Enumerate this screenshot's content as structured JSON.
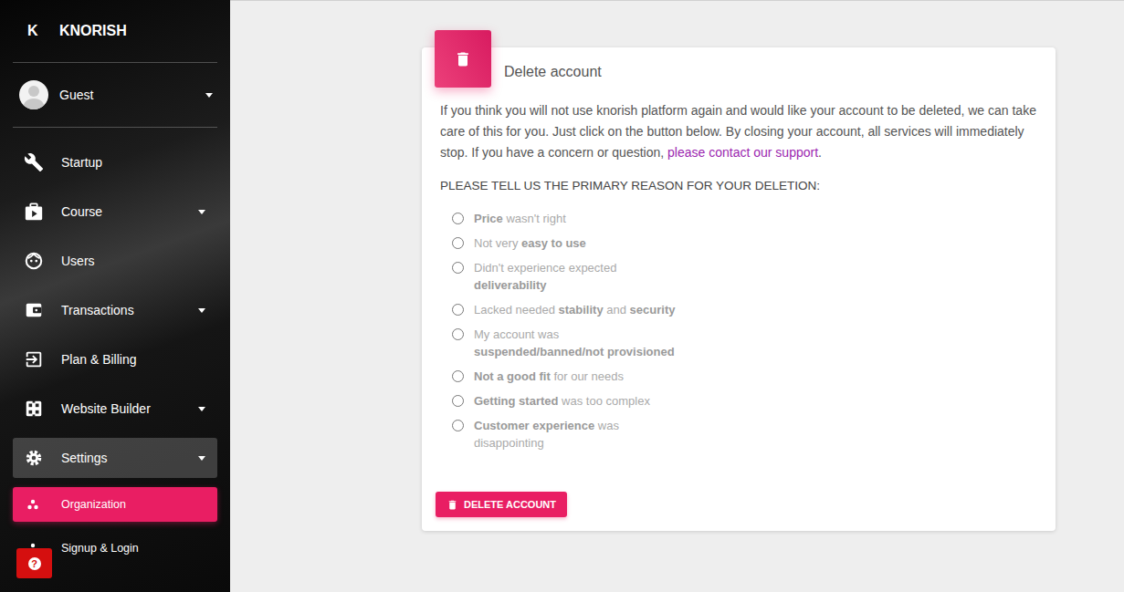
{
  "brand": {
    "logo": "K",
    "name": "KNORISH"
  },
  "user": {
    "name": "Guest",
    "expanded": false
  },
  "sidebar": {
    "items": [
      {
        "label": "Startup",
        "expandable": false,
        "expanded": false,
        "selected": false
      },
      {
        "label": "Course",
        "expandable": true,
        "expanded": false,
        "selected": false
      },
      {
        "label": "Users",
        "expandable": false,
        "expanded": false,
        "selected": false
      },
      {
        "label": "Transactions",
        "expandable": true,
        "expanded": false,
        "selected": false
      },
      {
        "label": "Plan & Billing",
        "expandable": false,
        "expanded": false,
        "selected": false
      },
      {
        "label": "Website Builder",
        "expandable": true,
        "expanded": false,
        "selected": false
      },
      {
        "label": "Settings",
        "expandable": true,
        "expanded": true,
        "selected": true
      }
    ],
    "sub_items": [
      {
        "label": "Organization",
        "selected": true
      },
      {
        "label": "Signup & Login",
        "selected": false
      }
    ]
  },
  "help_button": {
    "icon": "?"
  },
  "card": {
    "title": "Delete account",
    "intro": {
      "before": "If you think you will not use knorish platform again and would like your account to be deleted, we can take care of this for you. Just click on the button below. By closing your account, all services will immediately stop. If you have a concern or question, ",
      "link": "please contact our support",
      "after": "."
    },
    "question": "PLEASE TELL US THE PRIMARY REASON FOR YOUR DELETION:",
    "reasons": [
      {
        "selected": false,
        "segments": [
          {
            "text": "Price",
            "bold": true
          },
          {
            "text": " wasn't right",
            "bold": false
          }
        ]
      },
      {
        "selected": false,
        "segments": [
          {
            "text": "Not very ",
            "bold": false
          },
          {
            "text": "easy to use",
            "bold": true
          }
        ]
      },
      {
        "selected": false,
        "segments": [
          {
            "text": "Didn't experience expected ",
            "bold": false
          },
          {
            "text": "deliverability",
            "bold": true
          }
        ]
      },
      {
        "selected": false,
        "segments": [
          {
            "text": "Lacked needed ",
            "bold": false
          },
          {
            "text": "stability",
            "bold": true
          },
          {
            "text": " and ",
            "bold": false
          },
          {
            "text": "security",
            "bold": true
          }
        ]
      },
      {
        "selected": false,
        "segments": [
          {
            "text": "My account was ",
            "bold": false
          },
          {
            "text": "suspended/banned/not provisioned",
            "bold": true
          }
        ]
      },
      {
        "selected": false,
        "segments": [
          {
            "text": "Not a good fit",
            "bold": true
          },
          {
            "text": " for our needs",
            "bold": false
          }
        ]
      },
      {
        "selected": false,
        "segments": [
          {
            "text": "Getting started",
            "bold": true
          },
          {
            "text": " was too complex",
            "bold": false
          }
        ]
      },
      {
        "selected": false,
        "segments": [
          {
            "text": "Customer experience",
            "bold": true
          },
          {
            "text": " was disappointing",
            "bold": false
          }
        ]
      }
    ],
    "button": "DELETE ACCOUNT"
  }
}
